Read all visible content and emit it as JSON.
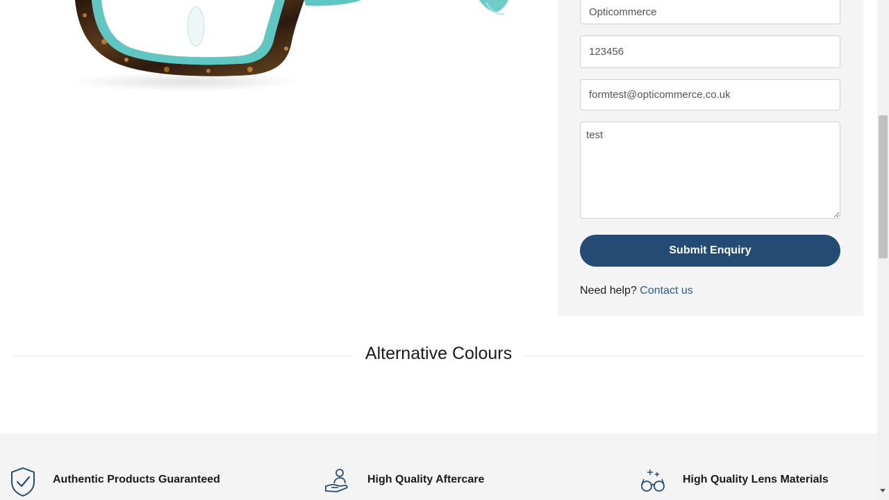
{
  "product": {
    "image_alt": "Tortoiseshell and turquoise rectangular glasses frame"
  },
  "enquiry_form": {
    "company_value": "Opticommerce",
    "phone_value": "123456",
    "email_value": "formtest@opticommerce.co.uk",
    "message_value": "test",
    "submit_label": "Submit Enquiry",
    "help_text": "Need help?",
    "contact_link": "Contact us"
  },
  "alternative_colours": {
    "heading": "Alternative Colours"
  },
  "features": [
    {
      "label": "Authentic Products Guaranteed",
      "icon": "shield-check-icon"
    },
    {
      "label": "High Quality Aftercare",
      "icon": "hand-care-icon"
    },
    {
      "label": "High Quality Lens Materials",
      "icon": "glasses-sparkle-icon"
    }
  ],
  "colors": {
    "primary": "#234b73",
    "link": "#2c5a8c",
    "panel_bg": "#f4f4f4",
    "frame_tortoise": "#3a2416",
    "frame_turquoise": "#5fc6c2"
  }
}
